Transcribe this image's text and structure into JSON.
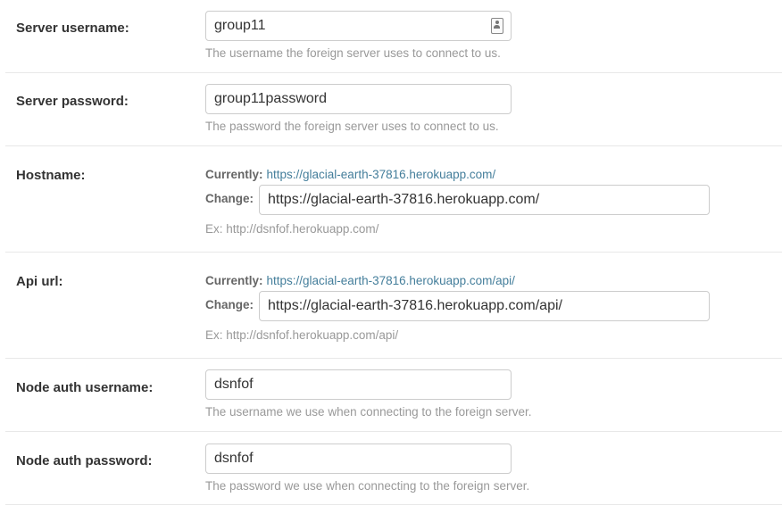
{
  "fields": {
    "server_username": {
      "label": "Server username:",
      "value": "group11",
      "help": "The username the foreign server uses to connect to us."
    },
    "server_password": {
      "label": "Server password:",
      "value": "group11password",
      "help": "The password the foreign server uses to connect to us."
    },
    "hostname": {
      "label": "Hostname:",
      "currently_label": "Currently:",
      "currently_link": "https://glacial-earth-37816.herokuapp.com/",
      "change_label": "Change:",
      "value": "https://glacial-earth-37816.herokuapp.com/",
      "help": "Ex: http://dsnfof.herokuapp.com/"
    },
    "api_url": {
      "label": "Api url:",
      "currently_label": "Currently:",
      "currently_link": "https://glacial-earth-37816.herokuapp.com/api/",
      "change_label": "Change:",
      "value": "https://glacial-earth-37816.herokuapp.com/api/",
      "help": "Ex: http://dsnfof.herokuapp.com/api/"
    },
    "node_auth_username": {
      "label": "Node auth username:",
      "value": "dsnfof",
      "help": "The username we use when connecting to the foreign server."
    },
    "node_auth_password": {
      "label": "Node auth password:",
      "value": "dsnfof",
      "help": "The password we use when connecting to the foreign server."
    }
  },
  "colors": {
    "link": "#447e9b",
    "help": "#999999",
    "label": "#333333",
    "border": "#cccccc",
    "divider": "#e8e8e8"
  },
  "icons": {
    "autofill": "contact-card-icon"
  }
}
